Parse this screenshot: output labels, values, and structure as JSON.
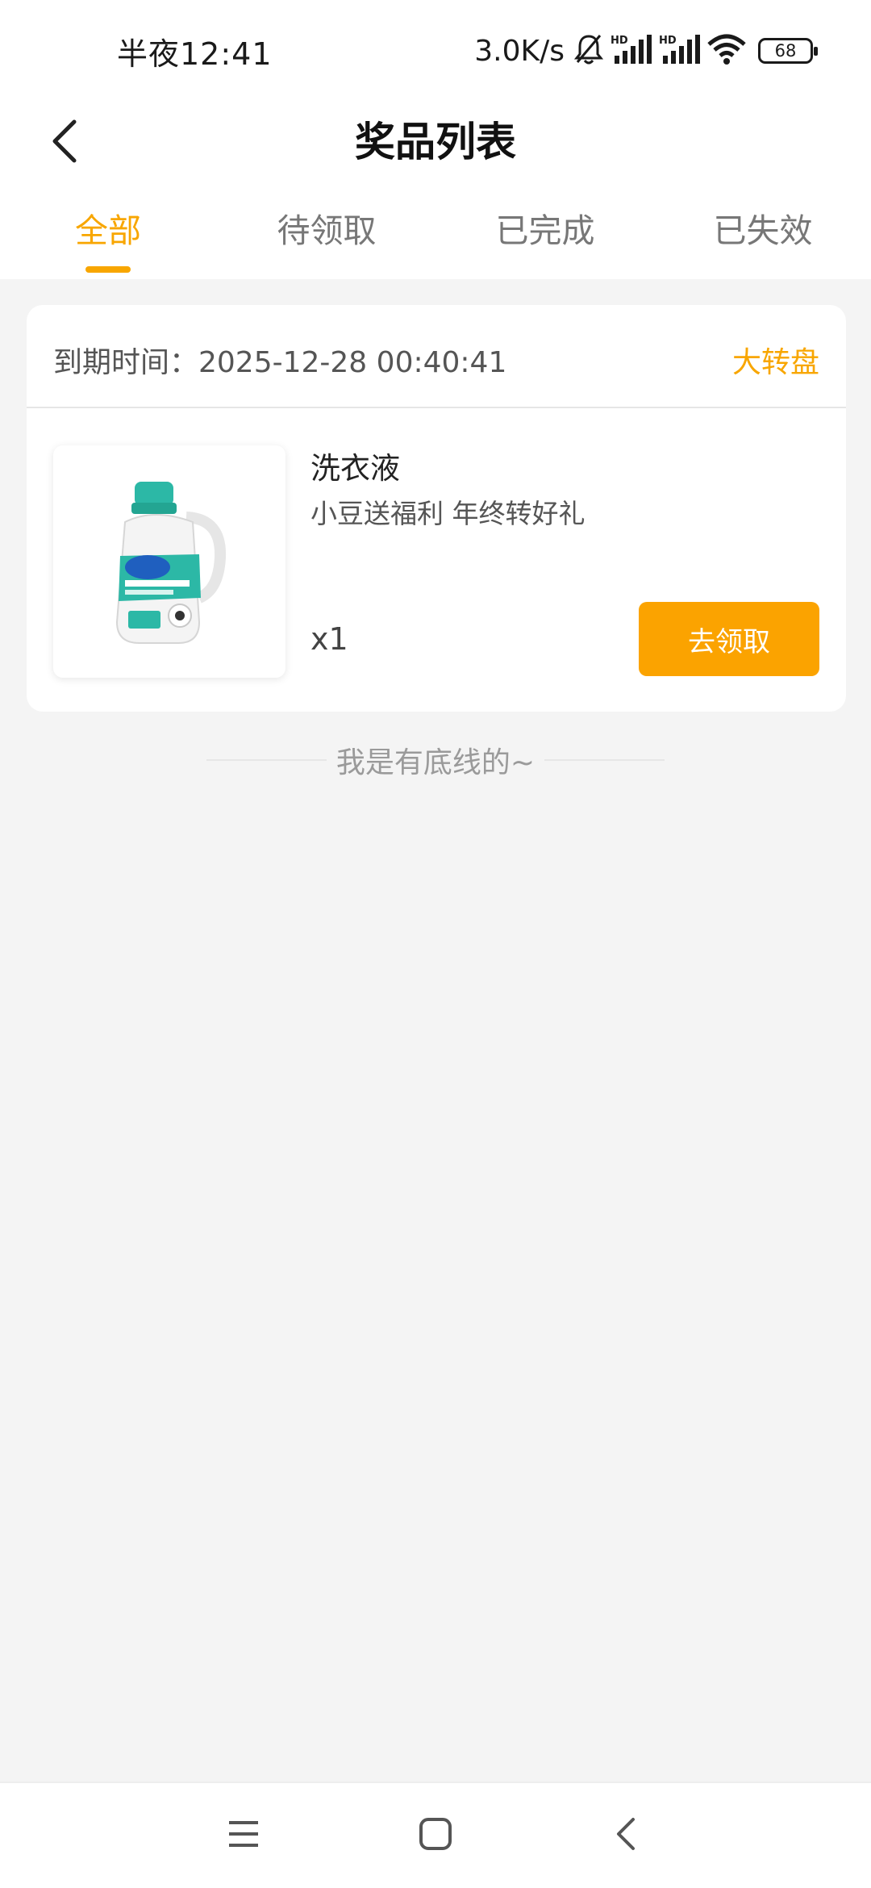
{
  "status_bar": {
    "time": "半夜12:41",
    "net_speed": "3.0K/s",
    "battery": "68",
    "icons": [
      "bell-muted-icon",
      "hd-signal-icon",
      "hd-signal-icon",
      "wifi-icon",
      "battery-icon"
    ]
  },
  "header": {
    "title": "奖品列表",
    "back_icon": "chevron-left-icon"
  },
  "tabs": [
    {
      "label": "全部",
      "active": true
    },
    {
      "label": "待领取",
      "active": false
    },
    {
      "label": "已完成",
      "active": false
    },
    {
      "label": "已失效",
      "active": false
    }
  ],
  "prize_card": {
    "expire_text": "到期时间：2025-12-28 00:40:41",
    "source": "大转盘",
    "product_name": "洗衣液",
    "product_desc": "小豆送福利 年终转好礼",
    "quantity": "x1",
    "claim_label": "去领取",
    "product_image": "laundry-detergent-bottle-image"
  },
  "end_text": "我是有底线的~",
  "system_nav": {
    "menu_icon": "menu-icon",
    "home_icon": "home-square-icon",
    "back_icon": "back-chevron-icon"
  },
  "colors": {
    "accent": "#f8a600",
    "button": "#fba300",
    "page_bg": "#f4f4f4",
    "teal": "#2cb8a6"
  }
}
